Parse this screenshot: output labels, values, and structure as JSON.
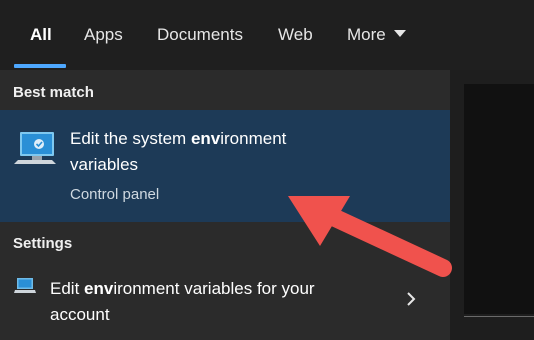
{
  "tabs": [
    {
      "label": "All",
      "active": true
    },
    {
      "label": "Apps"
    },
    {
      "label": "Documents"
    },
    {
      "label": "Web"
    },
    {
      "label": "More"
    }
  ],
  "best_match": {
    "section_label": "Best match",
    "title_part1": "Edit the system ",
    "title_bold": "env",
    "title_part2": "ironment",
    "title_line2": "variables",
    "subtitle": "Control panel",
    "icon": "monitor-settings-icon"
  },
  "settings": {
    "section_label": "Settings",
    "item_part1": "Edit ",
    "item_bold": "env",
    "item_part2": "ironment variables for your",
    "item_line2": "account",
    "icon": "laptop-settings-icon"
  },
  "colors": {
    "accent": "#4ea8ff",
    "highlight": "#1d3a57",
    "arrow": "#f0524d"
  }
}
